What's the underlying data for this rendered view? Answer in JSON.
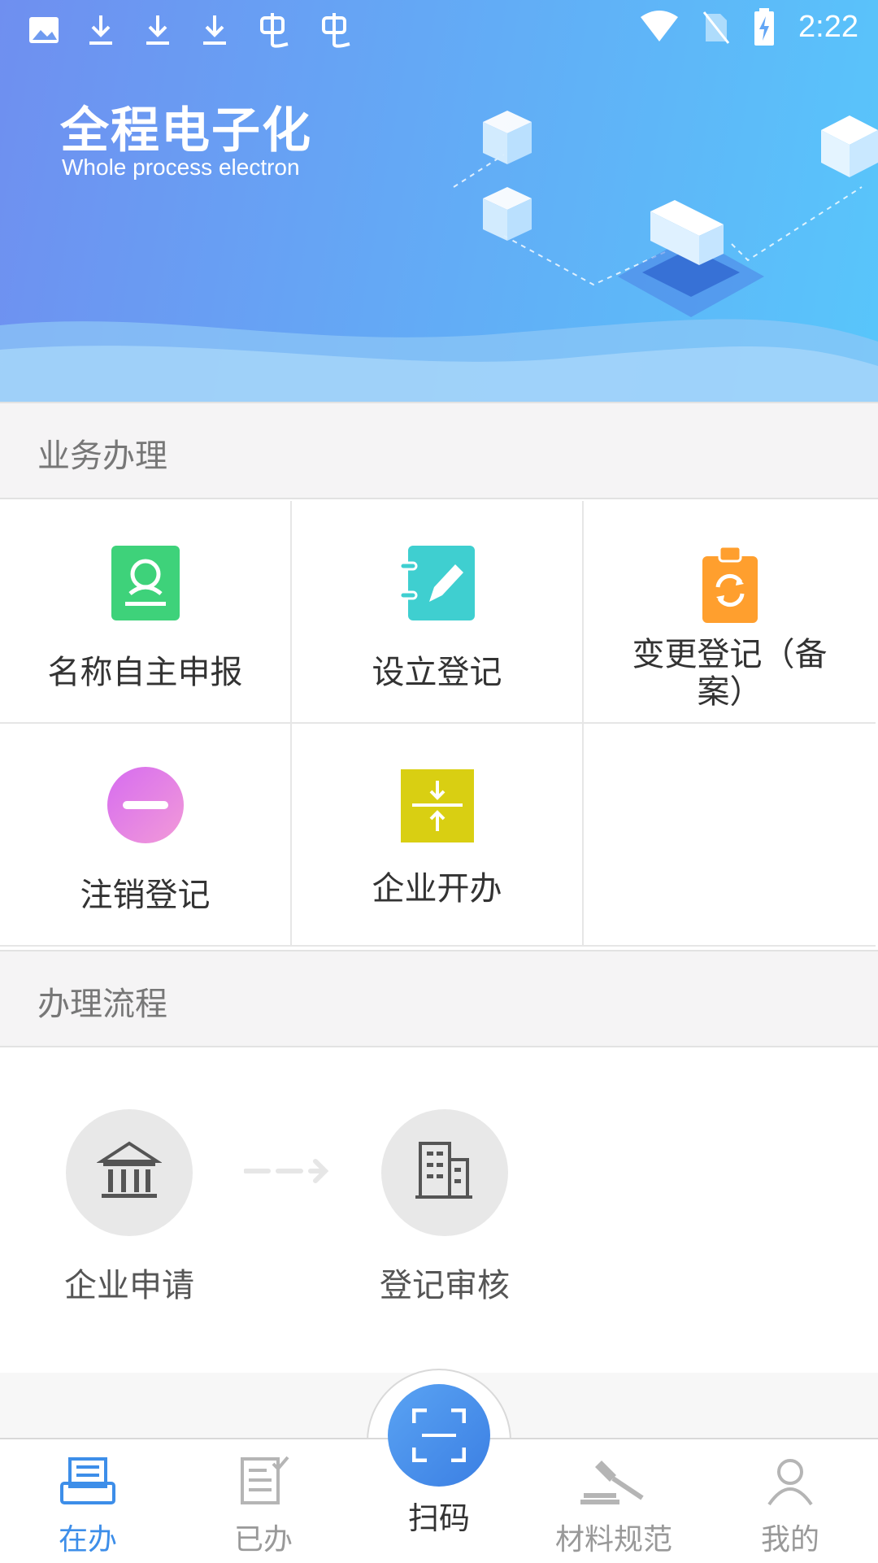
{
  "status_bar": {
    "time": "2:22",
    "left_icons": [
      "image-icon",
      "download-icon",
      "download-icon",
      "download-icon",
      "bug-icon",
      "bug-icon"
    ],
    "right_icons": [
      "wifi-icon",
      "no-sim-icon",
      "battery-charging-icon"
    ]
  },
  "banner": {
    "title": "全程电子化",
    "subtitle": "Whole process electron"
  },
  "sections": {
    "business": "业务办理",
    "process": "办理流程"
  },
  "services": [
    {
      "label": "名称自主申报",
      "icon": "contact-card-icon",
      "color": "#3ed27a"
    },
    {
      "label": "设立登记",
      "icon": "notebook-pen-icon",
      "color": "#3fcfd0"
    },
    {
      "label": "变更登记（备案）",
      "icon": "clipboard-refresh-icon",
      "color": "#ff9f2e"
    },
    {
      "label": "注销登记",
      "icon": "minus-circle-icon",
      "color": "#e07cf0"
    },
    {
      "label": "企业开办",
      "icon": "compress-icon",
      "color": "#d9cf12"
    }
  ],
  "process_steps": [
    {
      "label": "企业申请",
      "icon": "bank-icon"
    },
    {
      "label": "登记审核",
      "icon": "building-icon"
    }
  ],
  "bottom_nav": {
    "items": [
      {
        "label": "在办",
        "icon": "inbox-tray-icon",
        "active": true
      },
      {
        "label": "已办",
        "icon": "done-list-icon",
        "active": false
      },
      {
        "label": "扫码",
        "icon": "scan-icon",
        "active": false
      },
      {
        "label": "材料规范",
        "icon": "gavel-icon",
        "active": false
      },
      {
        "label": "我的",
        "icon": "user-icon",
        "active": false
      }
    ],
    "active_color": "#3d8ee9",
    "inactive_color": "#999999"
  }
}
